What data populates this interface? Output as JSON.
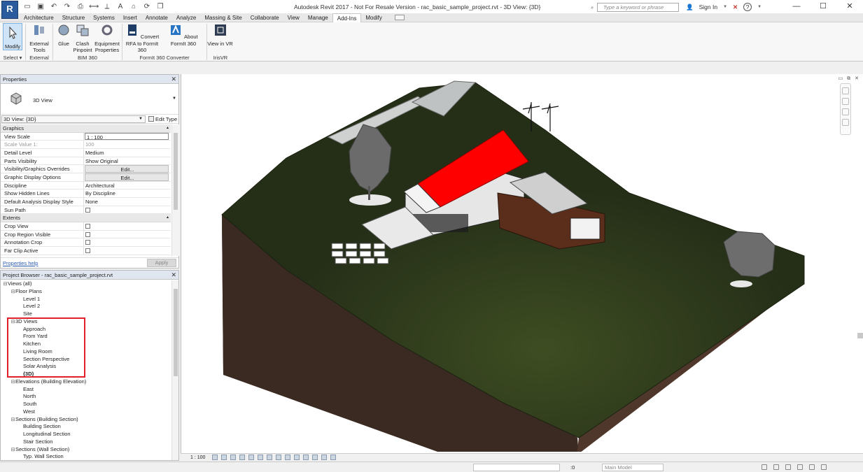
{
  "app": {
    "logo_letter": "R",
    "window_title": "Autodesk Revit 2017  -  Not For Resale Version  -    rac_basic_sample_project.rvt - 3D View: {3D}",
    "search_placeholder": "Type a keyword or phrase",
    "sign_in": "Sign In",
    "help": "?"
  },
  "tabs": [
    "Architecture",
    "Structure",
    "Systems",
    "Insert",
    "Annotate",
    "Analyze",
    "Massing & Site",
    "Collaborate",
    "View",
    "Manage",
    "Add-Ins",
    "Modify"
  ],
  "active_tab": "Add-Ins",
  "ribbon": {
    "modify": "Modify",
    "external_tools": "External Tools",
    "glue": "Glue",
    "clash_pinpoint": "Clash Pinpoint",
    "equipment_properties": "Equipment Properties",
    "convert_rfa": "Convert RFA to FormIt 360",
    "about_formit": "About FormIt 360",
    "view_in_vr": "View in VR",
    "panel_select": "Select",
    "panel_external": "External",
    "panel_bim360": "BIM 360",
    "panel_formit": "FormIt 360 Converter",
    "panel_irisvr": "IrisVR"
  },
  "properties": {
    "title": "Properties",
    "type_name": "3D View",
    "instance": "3D View: {3D}",
    "edit_type": "Edit Type",
    "help": "Properties help",
    "apply": "Apply",
    "groups": {
      "graphics": "Graphics",
      "extents": "Extents"
    },
    "graphics_rows": [
      {
        "k": "View Scale",
        "v": "1 : 100"
      },
      {
        "k": "Scale Value    1:",
        "v": "100"
      },
      {
        "k": "Detail Level",
        "v": "Medium"
      },
      {
        "k": "Parts Visibility",
        "v": "Show Original"
      },
      {
        "k": "Visibility/Graphics Overrides",
        "v": "Edit..."
      },
      {
        "k": "Graphic Display Options",
        "v": "Edit..."
      },
      {
        "k": "Discipline",
        "v": "Architectural"
      },
      {
        "k": "Show Hidden Lines",
        "v": "By Discipline"
      },
      {
        "k": "Default Analysis Display Style",
        "v": "None"
      },
      {
        "k": "Sun Path",
        "v": ""
      }
    ],
    "extents_rows": [
      {
        "k": "Crop View",
        "v": ""
      },
      {
        "k": "Crop Region Visible",
        "v": ""
      },
      {
        "k": "Annotation Crop",
        "v": ""
      },
      {
        "k": "Far Clip Active",
        "v": ""
      }
    ]
  },
  "browser": {
    "title": "Project Browser - rac_basic_sample_project.rvt",
    "nodes": [
      {
        "t": "Views (all)",
        "d": 0,
        "e": "-"
      },
      {
        "t": "Floor Plans",
        "d": 1,
        "e": "-"
      },
      {
        "t": "Level 1",
        "d": 2,
        "e": ""
      },
      {
        "t": "Level 2",
        "d": 2,
        "e": ""
      },
      {
        "t": "Site",
        "d": 2,
        "e": ""
      },
      {
        "t": "3D Views",
        "d": 1,
        "e": "-"
      },
      {
        "t": "Approach",
        "d": 2,
        "e": ""
      },
      {
        "t": "From Yard",
        "d": 2,
        "e": ""
      },
      {
        "t": "Kitchen",
        "d": 2,
        "e": ""
      },
      {
        "t": "Living Room",
        "d": 2,
        "e": ""
      },
      {
        "t": "Section Perspective",
        "d": 2,
        "e": ""
      },
      {
        "t": "Solar Analysis",
        "d": 2,
        "e": ""
      },
      {
        "t": "{3D}",
        "d": 2,
        "e": "",
        "b": true
      },
      {
        "t": "Elevations (Building Elevation)",
        "d": 1,
        "e": "-"
      },
      {
        "t": "East",
        "d": 2,
        "e": ""
      },
      {
        "t": "North",
        "d": 2,
        "e": ""
      },
      {
        "t": "South",
        "d": 2,
        "e": ""
      },
      {
        "t": "West",
        "d": 2,
        "e": ""
      },
      {
        "t": "Sections (Building Section)",
        "d": 1,
        "e": "-"
      },
      {
        "t": "Building Section",
        "d": 2,
        "e": ""
      },
      {
        "t": "Longitudinal Section",
        "d": 2,
        "e": ""
      },
      {
        "t": "Stair Section",
        "d": 2,
        "e": ""
      },
      {
        "t": "Sections (Wall Section)",
        "d": 1,
        "e": "-"
      },
      {
        "t": "Typ. Wall Section",
        "d": 2,
        "e": ""
      }
    ]
  },
  "view": {
    "scale": "1 : 100"
  },
  "status": {
    "model": "Main Model",
    "filter_count": ":0"
  },
  "colors": {
    "roof": "#ff0000",
    "terrain": "#2c3a1c",
    "soil": "#4a3428",
    "highlight": "#e0202a",
    "active_tab": "#ffffff"
  }
}
